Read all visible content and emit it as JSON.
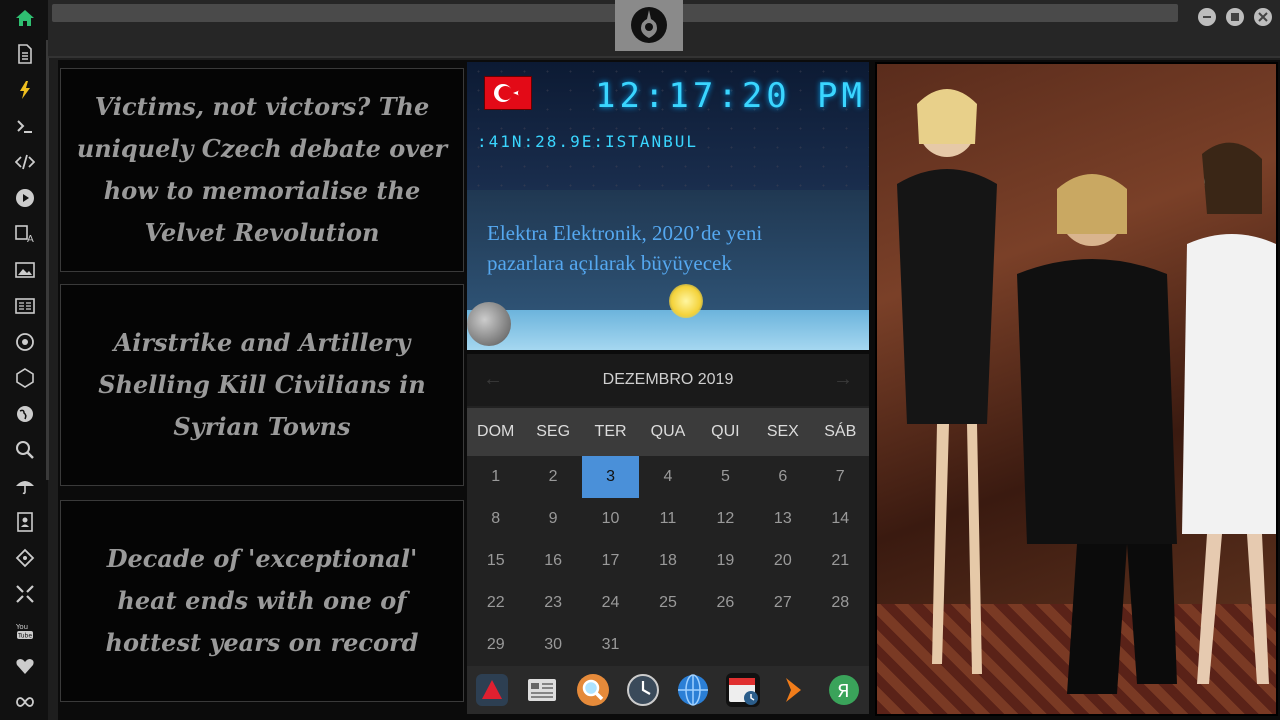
{
  "sidebar": {
    "items": [
      {
        "name": "home-icon"
      },
      {
        "name": "document-icon"
      },
      {
        "name": "lightning-icon"
      },
      {
        "name": "terminal-icon"
      },
      {
        "name": "code-icon"
      },
      {
        "name": "play-icon"
      },
      {
        "name": "translate-icon"
      },
      {
        "name": "image-icon"
      },
      {
        "name": "news-icon"
      },
      {
        "name": "aperture-icon"
      },
      {
        "name": "cube-icon"
      },
      {
        "name": "globe-icon"
      },
      {
        "name": "search-icon"
      },
      {
        "name": "umbrella-icon"
      },
      {
        "name": "contacts-icon"
      },
      {
        "name": "tag-icon"
      },
      {
        "name": "expand-icon"
      },
      {
        "name": "youtube-icon"
      },
      {
        "name": "heart-icon"
      },
      {
        "name": "infinity-icon"
      }
    ],
    "accent": "#2fbf71"
  },
  "topbar": {
    "logo": "rebel-alliance-icon"
  },
  "news": [
    {
      "title": "Victims, not victors? The uniquely Czech debate over how to memorialise the Velvet Revolution"
    },
    {
      "title": "Airstrike and Artillery Shelling Kill Civilians in Syrian Towns"
    },
    {
      "title": "Decade of 'exceptional' heat ends with one of hottest years on record"
    }
  ],
  "clock": {
    "time": "12:17:20",
    "ampm": "PM",
    "location": ":41N:28.9E:ISTANBUL",
    "headline": "Elektra Elektronik, 2020’de yeni pazarlara açılarak büyüyecek",
    "flag": "turkey"
  },
  "calendar": {
    "month_label": "DEZEMBRO 2019",
    "weekdays": [
      "DOM",
      "SEG",
      "TER",
      "QUA",
      "QUI",
      "SEX",
      "SÁB"
    ],
    "weeks": [
      [
        "1",
        "2",
        "3",
        "4",
        "5",
        "6",
        "7"
      ],
      [
        "8",
        "9",
        "10",
        "11",
        "12",
        "13",
        "14"
      ],
      [
        "15",
        "16",
        "17",
        "18",
        "19",
        "20",
        "21"
      ],
      [
        "22",
        "23",
        "24",
        "25",
        "26",
        "27",
        "28"
      ],
      [
        "29",
        "30",
        "31",
        "",
        "",
        "",
        ""
      ]
    ],
    "today": "3",
    "today_color": "#4a90d9"
  },
  "dock": {
    "apps": [
      {
        "name": "launcher-icon"
      },
      {
        "name": "news-reader-icon"
      },
      {
        "name": "magnifier-icon"
      },
      {
        "name": "clock-icon"
      },
      {
        "name": "browser-globe-icon"
      },
      {
        "name": "calendar-app-icon"
      },
      {
        "name": "next-arrow-icon"
      },
      {
        "name": "yandex-icon"
      }
    ]
  }
}
